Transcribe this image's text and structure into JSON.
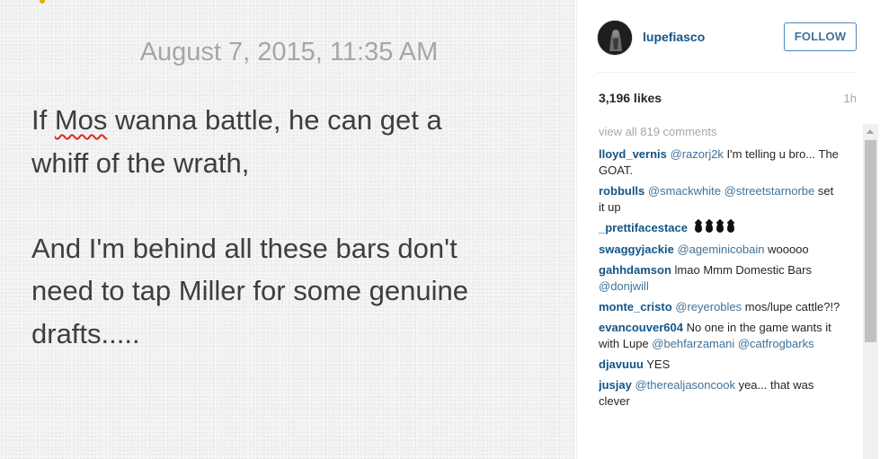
{
  "note": {
    "date": "August 7, 2015, 11:35 AM",
    "lines": [
      {
        "before": "If ",
        "flagged": "Mos",
        "after": " wanna battle, he can get a"
      },
      {
        "text": "whiff of the wrath,"
      },
      {
        "text": ""
      },
      {
        "text": "And I'm behind all these bars don't"
      },
      {
        "text": "need to tap Miller for some genuine"
      },
      {
        "text": "drafts....."
      }
    ]
  },
  "post": {
    "username": "lupefiasco",
    "follow_label": "FOLLOW",
    "likes": "3,196 likes",
    "time_ago": "1h",
    "view_all": "view all 819 comments"
  },
  "comments": [
    {
      "user": "lloyd_vernis",
      "parts": [
        {
          "m": "@razorj2k"
        },
        {
          "t": " I'm telling u bro... The GOAT."
        }
      ]
    },
    {
      "user": "robbulls",
      "parts": [
        {
          "m": "@smackwhite"
        },
        {
          "t": " "
        },
        {
          "m": "@streetstarnorbe"
        },
        {
          "t": " set it up"
        }
      ]
    },
    {
      "user": "_prettifacestace",
      "parts": [],
      "icons": [
        "drop-icon",
        "drop-icon",
        "drop-icon",
        "drop-icon"
      ]
    },
    {
      "user": "swaggyjackie",
      "parts": [
        {
          "m": "@ageminicobain"
        },
        {
          "t": " wooooo"
        }
      ]
    },
    {
      "user": "gahhdamson",
      "parts": [
        {
          "t": "lmao Mmm Domestic Bars "
        },
        {
          "m": "@donjwill"
        }
      ]
    },
    {
      "user": "monte_cristo",
      "parts": [
        {
          "m": "@reyerobles"
        },
        {
          "t": " mos/lupe cattle?!?"
        }
      ]
    },
    {
      "user": "evancouver604",
      "parts": [
        {
          "t": "No one in the game wants it with Lupe "
        },
        {
          "m": "@behfarzamani"
        },
        {
          "t": " "
        },
        {
          "m": "@catfrogbarks"
        }
      ]
    },
    {
      "user": "djavuuu",
      "parts": [
        {
          "t": "YES"
        }
      ]
    },
    {
      "user": "jusjay",
      "parts": [
        {
          "m": "@therealjasoncook"
        },
        {
          "t": " yea... that was clever"
        }
      ]
    }
  ],
  "colors": {
    "link_blue": "#125688",
    "mention_blue": "#3f729b",
    "note_text": "#3e3e3e",
    "note_date": "#a6a6a6",
    "spellcheck_red": "#e0281f"
  }
}
